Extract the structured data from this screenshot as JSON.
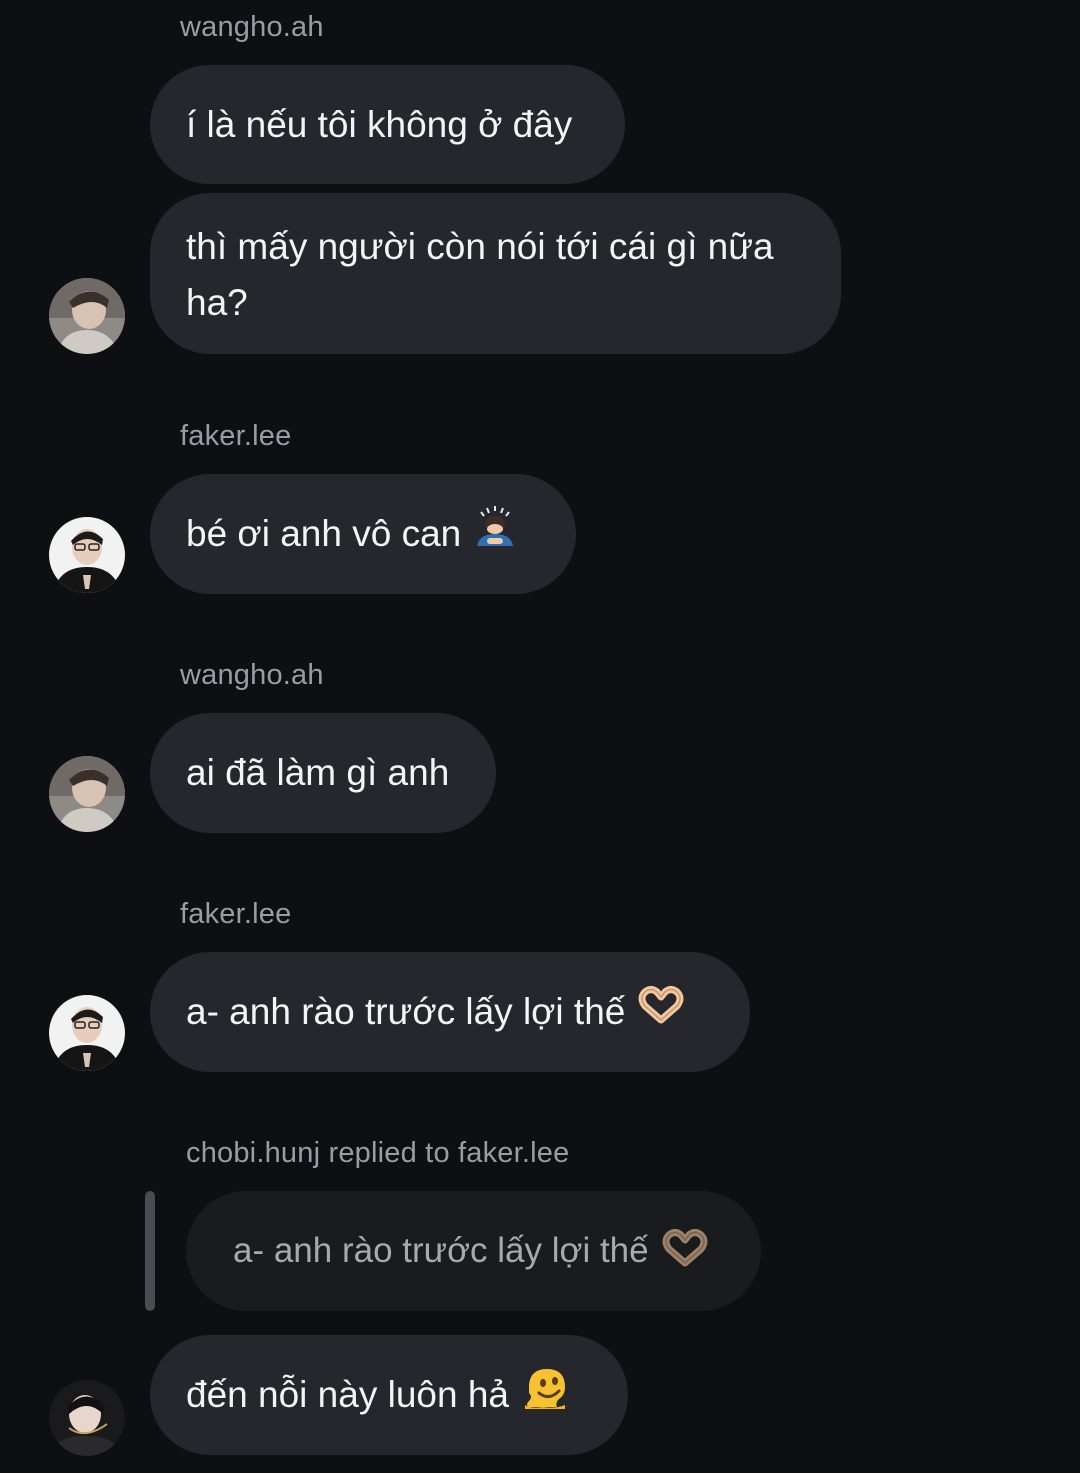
{
  "messages": [
    {
      "sender": "wangho.ah",
      "lines": [
        "í là nếu tôi không ở đây"
      ]
    },
    {
      "lines": [
        "thì mấy người còn nói tới cái gì nữa",
        "ha?"
      ]
    },
    {
      "sender": "faker.lee",
      "text": "bé ơi anh vô can",
      "emoji": "person-bowing-emoji"
    },
    {
      "sender": "wangho.ah",
      "text": "ai đã làm gì anh"
    },
    {
      "sender": "faker.lee",
      "text": "a- anh rào trước lấy lợi thế",
      "emoji": "heart-hands-emoji"
    },
    {
      "reply_header": "chobi.hunj replied to faker.lee",
      "quoted_text": "a- anh rào trước lấy lợi thế",
      "quoted_emoji": "heart-hands-emoji",
      "text": "đến nỗi này luôn hả",
      "emoji": "melting-face-emoji"
    }
  ],
  "colors": {
    "background": "#0e0f13",
    "bubble": "#25272c",
    "reply_bubble": "#1a1b1f",
    "sender_text": "#9a9ca3"
  }
}
